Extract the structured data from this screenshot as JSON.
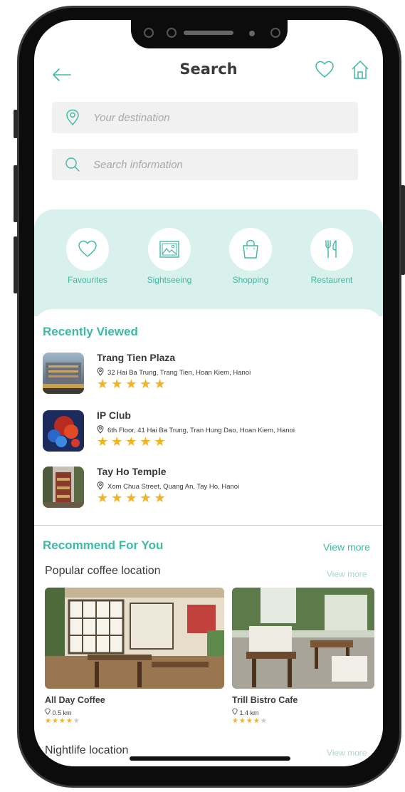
{
  "header": {
    "title": "Search"
  },
  "search": {
    "destination_placeholder": "Your destination",
    "info_placeholder": "Search information"
  },
  "categories": [
    {
      "label": "Favourites",
      "icon": "heart-icon"
    },
    {
      "label": "Sightseeing",
      "icon": "picture-icon"
    },
    {
      "label": "Shopping",
      "icon": "shopping-bag-icon"
    },
    {
      "label": "Restaurent",
      "icon": "fork-knife-icon"
    }
  ],
  "recently_viewed": {
    "title": "Recently Viewed",
    "items": [
      {
        "name": "Trang Tien Plaza",
        "address": "32 Hai Ba Trung, Trang Tien, Hoan Kiem, Hanoi",
        "rating": 5
      },
      {
        "name": "IP Club",
        "address": "6th Floor, 41 Hai Ba Trung, Tran Hung Dao, Hoan Kiem, Hanoi",
        "rating": 5
      },
      {
        "name": "Tay Ho Temple",
        "address": "Xom Chua Street, Quang An, Tay Ho, Hanoi",
        "rating": 5
      }
    ]
  },
  "recommend": {
    "title": "Recommend For You",
    "view_more": "View more",
    "coffee": {
      "title": "Popular coffee location",
      "view_more": "View more",
      "items": [
        {
          "name": "All Day Coffee",
          "distance": "0.5 km",
          "rating": 4
        },
        {
          "name": "Trill Bistro Cafe",
          "distance": "1.4 km",
          "rating": 4
        }
      ]
    },
    "nightlife": {
      "title": "Nightlife location",
      "view_more": "View more"
    }
  },
  "colors": {
    "accent": "#3fb8a5",
    "star": "#f5b21b",
    "category_bg": "#d8f1ec"
  }
}
